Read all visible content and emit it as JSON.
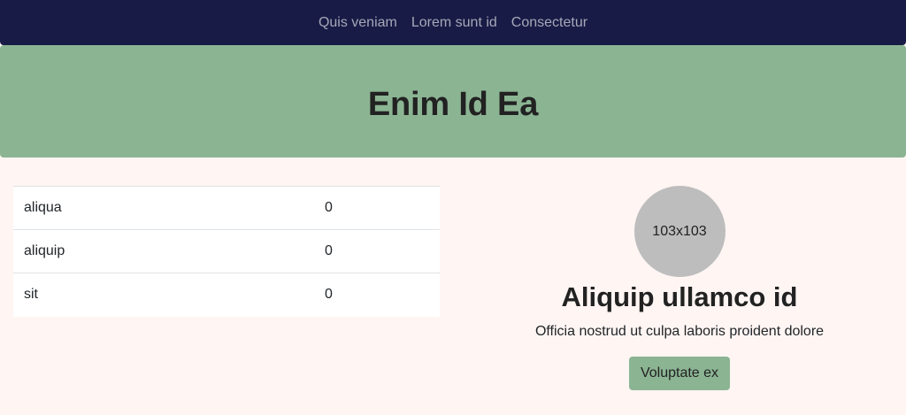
{
  "nav": {
    "links": [
      "Quis veniam",
      "Lorem sunt id",
      "Consectetur"
    ]
  },
  "hero": {
    "title": "Enim Id Ea"
  },
  "table": {
    "rows": [
      {
        "name": "aliqua",
        "value": "0"
      },
      {
        "name": "aliquip",
        "value": "0"
      },
      {
        "name": "sit",
        "value": "0"
      }
    ]
  },
  "profile": {
    "avatar_text": "103x103",
    "title": "Aliquip ullamco id",
    "text": "Officia nostrud ut culpa laboris proident dolore",
    "button_label": "Voluptate ex"
  },
  "colors": {
    "navbar": "#181b45",
    "accent": "#8bb493",
    "background": "#fff5f3",
    "avatar": "#bdbdbd"
  }
}
